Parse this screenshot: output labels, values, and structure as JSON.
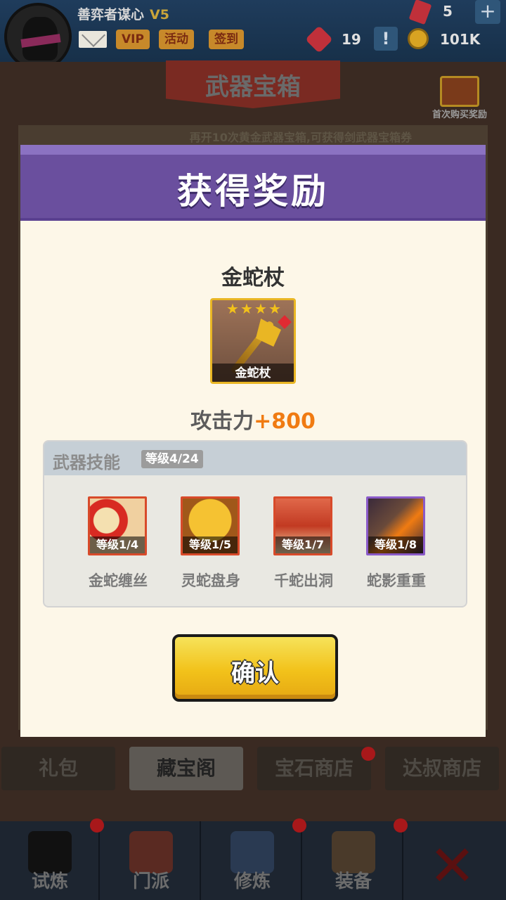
{
  "topbar": {
    "player_name": "善弈者谋心",
    "vip_level": "V5",
    "tags": {
      "vip": "VIP",
      "activity": "活动",
      "signin": "签到"
    },
    "gems": "5",
    "plus": "+",
    "badges": "19",
    "alert": "!",
    "coins": "101K"
  },
  "screen": {
    "title": "武器宝箱",
    "first_buy_label": "首次购买奖励",
    "hint": "再开10次黄金武器宝箱,可获得剑武器宝箱券"
  },
  "modal": {
    "title": "获得奖励",
    "item": {
      "name": "金蛇杖",
      "card_label": "金蛇杖",
      "stars": 4,
      "attack_label": "攻击力",
      "attack_value": "+800"
    },
    "skills": {
      "title": "武器技能",
      "level_badge": "等级4/24",
      "items": [
        {
          "level": "等级1/4",
          "name": "金蛇缠丝",
          "frame": "red"
        },
        {
          "level": "等级1/5",
          "name": "灵蛇盘身",
          "frame": "red"
        },
        {
          "level": "等级1/7",
          "name": "千蛇出洞",
          "frame": "red"
        },
        {
          "level": "等级1/8",
          "name": "蛇影重重",
          "frame": "purple"
        }
      ]
    },
    "confirm_label": "确认"
  },
  "shop_tabs": [
    {
      "label": "礼包",
      "active": false
    },
    {
      "label": "藏宝阁",
      "active": true
    },
    {
      "label": "宝石商店",
      "active": false
    },
    {
      "label": "达叔商店",
      "active": false
    }
  ],
  "bottom_nav": [
    {
      "label": "试炼",
      "icon": "ninja-icon"
    },
    {
      "label": "门派",
      "icon": "temple-icon"
    },
    {
      "label": "修炼",
      "icon": "book-icon"
    },
    {
      "label": "装备",
      "icon": "sword-icon"
    }
  ],
  "colors": {
    "header_purple": "#6a4f9e",
    "attack_orange": "#f07b12",
    "confirm_yellow": "#f2c21a",
    "star_gold": "#f2c21a"
  }
}
